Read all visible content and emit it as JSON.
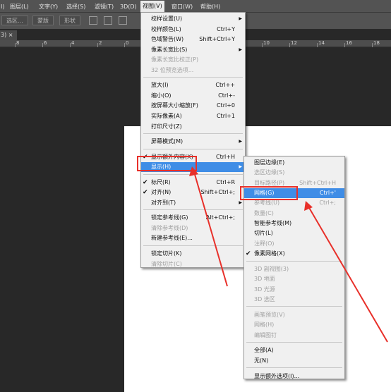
{
  "menubar": {
    "items": [
      {
        "label": "I)"
      },
      {
        "label": "图层(L)"
      },
      {
        "label": "文字(Y)"
      },
      {
        "label": "选择(S)"
      },
      {
        "label": "滤镜(T)"
      },
      {
        "label": "3D(D)"
      },
      {
        "label": "视图(V)"
      },
      {
        "label": "窗口(W)"
      },
      {
        "label": "帮助(H)"
      }
    ]
  },
  "options": {
    "selection_label": "选区...",
    "mask_label": "蒙版",
    "shape_label": "形状"
  },
  "doc_tab": {
    "label": "3) ×"
  },
  "ruler": {
    "labels": [
      "8",
      "6",
      "4",
      "2",
      "0",
      "10",
      "12",
      "14",
      "16",
      "18"
    ]
  },
  "view_menu": {
    "items": [
      {
        "label": "校样设置(U)",
        "shortcut": "",
        "submenu": true,
        "disabled": false,
        "checked": false
      },
      {
        "label": "校样颜色(L)",
        "shortcut": "Ctrl+Y",
        "submenu": false,
        "disabled": false,
        "checked": false
      },
      {
        "label": "色域警告(W)",
        "shortcut": "Shift+Ctrl+Y",
        "submenu": false,
        "disabled": false,
        "checked": false
      },
      {
        "label": "像素长宽比(S)",
        "shortcut": "",
        "submenu": true,
        "disabled": false,
        "checked": false
      },
      {
        "label": "像素长宽比校正(P)",
        "shortcut": "",
        "submenu": false,
        "disabled": true,
        "checked": false
      },
      {
        "label": "32 位预览选项...",
        "shortcut": "",
        "submenu": false,
        "disabled": true,
        "checked": false
      },
      {
        "label": "放大(I)",
        "shortcut": "Ctrl++",
        "submenu": false,
        "disabled": false,
        "checked": false
      },
      {
        "label": "缩小(O)",
        "shortcut": "Ctrl+-",
        "submenu": false,
        "disabled": false,
        "checked": false
      },
      {
        "label": "按屏幕大小缩放(F)",
        "shortcut": "Ctrl+0",
        "submenu": false,
        "disabled": false,
        "checked": false
      },
      {
        "label": "实际像素(A)",
        "shortcut": "Ctrl+1",
        "submenu": false,
        "disabled": false,
        "checked": false
      },
      {
        "label": "打印尺寸(Z)",
        "shortcut": "",
        "submenu": false,
        "disabled": false,
        "checked": false
      },
      {
        "label": "屏幕模式(M)",
        "shortcut": "",
        "submenu": true,
        "disabled": false,
        "checked": false
      },
      {
        "label": "显示额外内容(X)",
        "shortcut": "Ctrl+H",
        "submenu": false,
        "disabled": false,
        "checked": true
      },
      {
        "label": "显示(H)",
        "shortcut": "",
        "submenu": true,
        "disabled": false,
        "checked": false,
        "highlighted": true
      },
      {
        "label": "标尺(R)",
        "shortcut": "Ctrl+R",
        "submenu": false,
        "disabled": false,
        "checked": true
      },
      {
        "label": "对齐(N)",
        "shortcut": "Shift+Ctrl+;",
        "submenu": false,
        "disabled": false,
        "checked": true
      },
      {
        "label": "对齐到(T)",
        "shortcut": "",
        "submenu": true,
        "disabled": false,
        "checked": false
      },
      {
        "label": "锁定参考线(G)",
        "shortcut": "Alt+Ctrl+;",
        "submenu": false,
        "disabled": false,
        "checked": false
      },
      {
        "label": "清除参考线(D)",
        "shortcut": "",
        "submenu": false,
        "disabled": true,
        "checked": false
      },
      {
        "label": "新建参考线(E)...",
        "shortcut": "",
        "submenu": false,
        "disabled": false,
        "checked": false
      },
      {
        "label": "锁定切片(K)",
        "shortcut": "",
        "submenu": false,
        "disabled": false,
        "checked": false
      },
      {
        "label": "清除切片(C)",
        "shortcut": "",
        "submenu": false,
        "disabled": true,
        "checked": false
      }
    ]
  },
  "show_submenu": {
    "items": [
      {
        "label": "图层边缘(E)",
        "shortcut": "",
        "disabled": false,
        "checked": false
      },
      {
        "label": "选区边缘(S)",
        "shortcut": "",
        "disabled": true,
        "checked": false
      },
      {
        "label": "目标路径(P)",
        "shortcut": "Shift+Ctrl+H",
        "disabled": true,
        "checked": false
      },
      {
        "label": "网格(G)",
        "shortcut": "Ctrl+'",
        "disabled": false,
        "checked": false,
        "highlighted": true
      },
      {
        "label": "参考线(U)",
        "shortcut": "Ctrl+;",
        "disabled": true,
        "checked": false
      },
      {
        "label": "数量(C)",
        "shortcut": "",
        "disabled": true,
        "checked": false
      },
      {
        "label": "智能参考线(M)",
        "shortcut": "",
        "disabled": false,
        "checked": false
      },
      {
        "label": "切片(L)",
        "shortcut": "",
        "disabled": false,
        "checked": false
      },
      {
        "label": "注释(O)",
        "shortcut": "",
        "disabled": true,
        "checked": false
      },
      {
        "label": "像素网格(X)",
        "shortcut": "",
        "disabled": false,
        "checked": true
      },
      {
        "label": "3D 副视图(3)",
        "shortcut": "",
        "disabled": true,
        "checked": false
      },
      {
        "label": "3D 地面",
        "shortcut": "",
        "disabled": true,
        "checked": false
      },
      {
        "label": "3D 光源",
        "shortcut": "",
        "disabled": true,
        "checked": false
      },
      {
        "label": "3D 选区",
        "shortcut": "",
        "disabled": true,
        "checked": false
      },
      {
        "label": "画笔预览(V)",
        "shortcut": "",
        "disabled": true,
        "checked": false
      },
      {
        "label": "网格(H)",
        "shortcut": "",
        "disabled": true,
        "checked": false
      },
      {
        "label": "编辑图钉",
        "shortcut": "",
        "disabled": true,
        "checked": false
      },
      {
        "label": "全部(A)",
        "shortcut": "",
        "disabled": false,
        "checked": false
      },
      {
        "label": "无(N)",
        "shortcut": "",
        "disabled": false,
        "checked": false
      },
      {
        "label": "显示额外选项(I)...",
        "shortcut": "",
        "disabled": false,
        "checked": false
      }
    ]
  },
  "colors": {
    "menu_bg": "#f0f0f0",
    "highlight": "#3f8de6",
    "annotation_red": "#e8302a",
    "workspace": "#282828"
  }
}
